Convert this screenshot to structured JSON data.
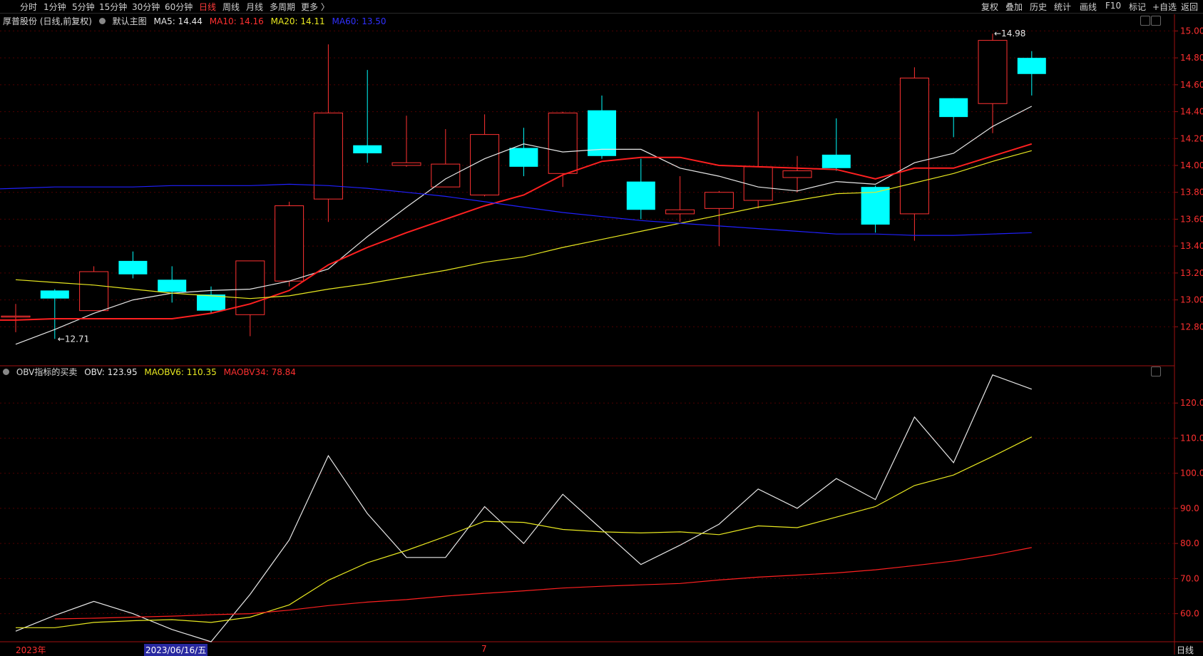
{
  "toolbar": {
    "periods": [
      "分时",
      "1分钟",
      "5分钟",
      "15分钟",
      "30分钟",
      "60分钟",
      "日线",
      "周线",
      "月线",
      "多周期",
      "更多 〉"
    ],
    "active_period": "日线",
    "right_items": [
      "复权",
      "叠加",
      "历史",
      "统计",
      "画线",
      "F10",
      "标记",
      "+自选",
      "返回"
    ]
  },
  "main_legend": {
    "stock": "厚普股份 (日线,前复权)",
    "chart_type": "默认主图",
    "ma5": "MA5: 14.44",
    "ma10": "MA10: 14.16",
    "ma20": "MA20: 14.11",
    "ma60": "MA60: 13.50"
  },
  "sub_legend": {
    "indicator": "OBV指标的买卖",
    "obv": "OBV: 123.95",
    "maobv6": "MAOBV6: 110.35",
    "maobv34": "MAOBV34: 78.84"
  },
  "annotations": {
    "low": "12.71",
    "high": "14.98"
  },
  "bottom": {
    "year": "2023年",
    "cursor_date": "2023/06/16/五",
    "month": "7",
    "period": "日线"
  },
  "colors": {
    "up": "#ff3232",
    "down": "#00ffff",
    "ma5": "#e8e8e8",
    "ma10": "#ff2020",
    "ma20": "#e8e820",
    "ma60": "#2020ff",
    "obv": "#e8e8e8",
    "maobv6": "#e8e820",
    "maobv34": "#ff2020",
    "axis": "#a01010",
    "grid": "#500000"
  },
  "chart_data": [
    {
      "type": "candlestick",
      "title": "厚普股份 (日线,前复权)",
      "ylim": [
        12.6,
        15.05
      ],
      "yticks": [
        12.8,
        13.0,
        13.2,
        13.4,
        13.6,
        13.8,
        14.0,
        14.2,
        14.4,
        14.6,
        14.8,
        15.0
      ],
      "candles": [
        {
          "o": 12.88,
          "h": 12.97,
          "l": 12.76,
          "c": 12.88
        },
        {
          "o": 13.07,
          "h": 13.08,
          "l": 12.71,
          "c": 13.01
        },
        {
          "o": 12.92,
          "h": 13.25,
          "l": 12.92,
          "c": 13.21
        },
        {
          "o": 13.29,
          "h": 13.36,
          "l": 13.16,
          "c": 13.19
        },
        {
          "o": 13.15,
          "h": 13.25,
          "l": 12.98,
          "c": 13.06
        },
        {
          "o": 13.04,
          "h": 13.1,
          "l": 12.9,
          "c": 12.92
        },
        {
          "o": 12.89,
          "h": 13.29,
          "l": 12.73,
          "c": 13.29
        },
        {
          "o": 13.14,
          "h": 13.73,
          "l": 13.1,
          "c": 13.7
        },
        {
          "o": 13.75,
          "h": 14.9,
          "l": 13.58,
          "c": 14.39
        },
        {
          "o": 14.15,
          "h": 14.71,
          "l": 14.02,
          "c": 14.09
        },
        {
          "o": 14.0,
          "h": 14.37,
          "l": 13.99,
          "c": 14.02
        },
        {
          "o": 13.84,
          "h": 14.27,
          "l": 13.84,
          "c": 14.01
        },
        {
          "o": 13.78,
          "h": 14.38,
          "l": 13.77,
          "c": 14.23
        },
        {
          "o": 14.13,
          "h": 14.28,
          "l": 13.92,
          "c": 13.99
        },
        {
          "o": 13.94,
          "h": 14.4,
          "l": 13.84,
          "c": 14.39
        },
        {
          "o": 14.41,
          "h": 14.52,
          "l": 14.05,
          "c": 14.07
        },
        {
          "o": 13.88,
          "h": 14.05,
          "l": 13.6,
          "c": 13.67
        },
        {
          "o": 13.64,
          "h": 13.92,
          "l": 13.58,
          "c": 13.67
        },
        {
          "o": 13.68,
          "h": 13.81,
          "l": 13.4,
          "c": 13.8
        },
        {
          "o": 13.74,
          "h": 14.4,
          "l": 13.68,
          "c": 13.99
        },
        {
          "o": 13.91,
          "h": 14.07,
          "l": 13.8,
          "c": 13.96
        },
        {
          "o": 14.08,
          "h": 14.35,
          "l": 13.96,
          "c": 13.98
        },
        {
          "o": 13.84,
          "h": 13.85,
          "l": 13.5,
          "c": 13.56
        },
        {
          "o": 13.64,
          "h": 14.73,
          "l": 13.44,
          "c": 14.65
        },
        {
          "o": 14.5,
          "h": 14.5,
          "l": 14.21,
          "c": 14.36
        },
        {
          "o": 14.46,
          "h": 14.98,
          "l": 14.24,
          "c": 14.93
        },
        {
          "o": 14.8,
          "h": 14.85,
          "l": 14.52,
          "c": 14.68
        }
      ],
      "series": [
        {
          "name": "MA5",
          "values": [
            12.67,
            12.78,
            12.9,
            13.0,
            13.05,
            13.07,
            13.08,
            13.14,
            13.23,
            13.47,
            13.69,
            13.9,
            14.05,
            14.16,
            14.1,
            14.12,
            14.12,
            13.98,
            13.92,
            13.84,
            13.81,
            13.88,
            13.86,
            14.02,
            14.09,
            14.29,
            14.44
          ]
        },
        {
          "name": "MA10",
          "values": [
            12.85,
            12.85,
            12.85,
            12.86,
            12.86,
            12.86,
            12.86,
            12.9,
            12.97,
            13.07,
            13.26,
            13.39,
            13.5,
            13.6,
            13.7,
            13.78,
            13.93,
            14.03,
            14.06,
            14.06,
            14.0,
            13.99,
            13.98,
            13.97,
            13.9,
            13.98,
            13.98,
            14.07,
            14.16
          ]
        },
        {
          "name": "MA20",
          "values": [
            13.15,
            13.13,
            13.11,
            13.08,
            13.05,
            13.03,
            13.01,
            13.03,
            13.08,
            13.12,
            13.17,
            13.22,
            13.28,
            13.32,
            13.39,
            13.45,
            13.51,
            13.57,
            13.63,
            13.69,
            13.74,
            13.79,
            13.8,
            13.87,
            13.94,
            14.03,
            14.11
          ]
        },
        {
          "name": "MA60",
          "values": [
            13.8,
            13.81,
            13.82,
            13.83,
            13.84,
            13.84,
            13.84,
            13.85,
            13.85,
            13.85,
            13.86,
            13.85,
            13.83,
            13.8,
            13.77,
            13.73,
            13.69,
            13.65,
            13.62,
            13.59,
            13.57,
            13.55,
            13.53,
            13.51,
            13.49,
            13.49,
            13.48,
            13.48,
            13.49,
            13.5
          ]
        }
      ]
    },
    {
      "type": "line",
      "title": "OBV指标的买卖",
      "ylim": [
        52,
        130
      ],
      "yticks": [
        60.0,
        70.0,
        80.0,
        90.0,
        100.0,
        110.0,
        120.0
      ],
      "series": [
        {
          "name": "OBV",
          "values": [
            55,
            59.5,
            63.5,
            60,
            55.5,
            52,
            65.5,
            81,
            105,
            88.5,
            76,
            76,
            90.5,
            80,
            94,
            84,
            74,
            79.5,
            85.5,
            95.5,
            90,
            98.5,
            92.5,
            116,
            103,
            128,
            123.95
          ]
        },
        {
          "name": "MAOBV6",
          "values": [
            56,
            56,
            57.5,
            58,
            58.3,
            57.5,
            59,
            62.5,
            69.5,
            74.5,
            78,
            82,
            86.3,
            86,
            84,
            83.3,
            83,
            83.3,
            82.5,
            85,
            84.5,
            87.5,
            90.5,
            96.5,
            99.5,
            104.8,
            110.35
          ]
        },
        {
          "name": "MAOBV34",
          "values": [
            58.5,
            58.7,
            59,
            59.3,
            59.7,
            60,
            61,
            62.3,
            63.3,
            64,
            65,
            65.8,
            66.5,
            67.3,
            67.8,
            68.2,
            68.6,
            69.6,
            70.4,
            71,
            71.6,
            72.5,
            73.7,
            75,
            76.7,
            78.84
          ]
        }
      ]
    }
  ]
}
